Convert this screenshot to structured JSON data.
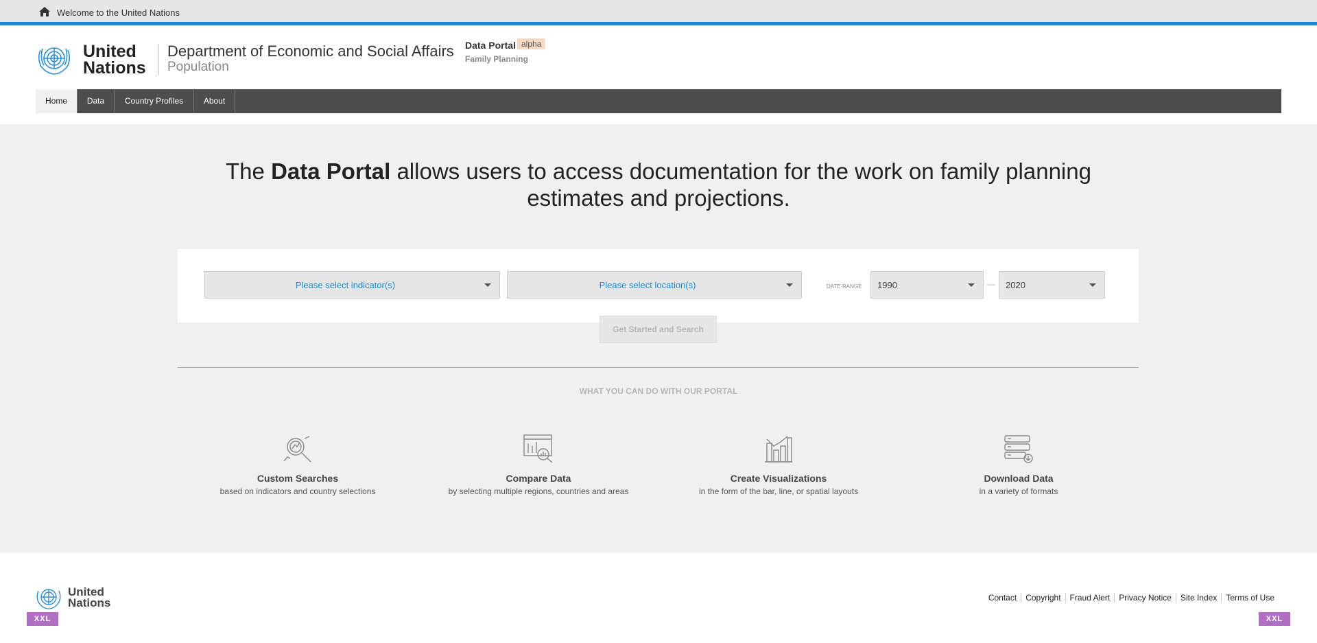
{
  "topbar": {
    "welcome": "Welcome to the United Nations",
    "icon": "home-icon"
  },
  "header": {
    "org_line1": "United",
    "org_line2": "Nations",
    "department": "Department of Economic and Social Affairs",
    "division": "Population",
    "portal": "Data Portal",
    "badge": "alpha",
    "portal_sub": "Family Planning"
  },
  "nav": {
    "items": [
      "Home",
      "Data",
      "Country Profiles",
      "About"
    ],
    "active": "Home"
  },
  "hero": {
    "before": "The ",
    "bold": "Data Portal",
    "after": " allows users to access documentation for the work on family planning estimates and projections."
  },
  "search": {
    "indicator_placeholder": "Please select indicator(s)",
    "location_placeholder": "Please select location(s)",
    "date_range_label": "DATE RANGE",
    "start_year": "1990",
    "separator": "—",
    "end_year": "2020",
    "button": "Get Started and Search"
  },
  "features": {
    "section_title": "WHAT YOU CAN DO WITH OUR PORTAL",
    "items": [
      {
        "title": "Custom Searches",
        "desc": "based on indicators and country selections",
        "icon": "search-analytics-icon"
      },
      {
        "title": "Compare Data",
        "desc": "by selecting multiple regions, countries and areas",
        "icon": "compare-data-icon"
      },
      {
        "title": "Create Visualizations",
        "desc": "in the form of the bar, line, or spatial layouts",
        "icon": "bar-chart-icon"
      },
      {
        "title": "Download Data",
        "desc": "in a variety of formats",
        "icon": "download-database-icon"
      }
    ]
  },
  "footer": {
    "org_line1": "United",
    "org_line2": "Nations",
    "links": [
      "Contact",
      "Copyright",
      "Fraud Alert",
      "Privacy Notice",
      "Site Index",
      "Terms of Use"
    ],
    "breakpoint_badge": "XXL"
  },
  "colors": {
    "accent": "#1a8bd0",
    "nav_bg": "#4d4d4d",
    "badge": "#b06fc3"
  }
}
